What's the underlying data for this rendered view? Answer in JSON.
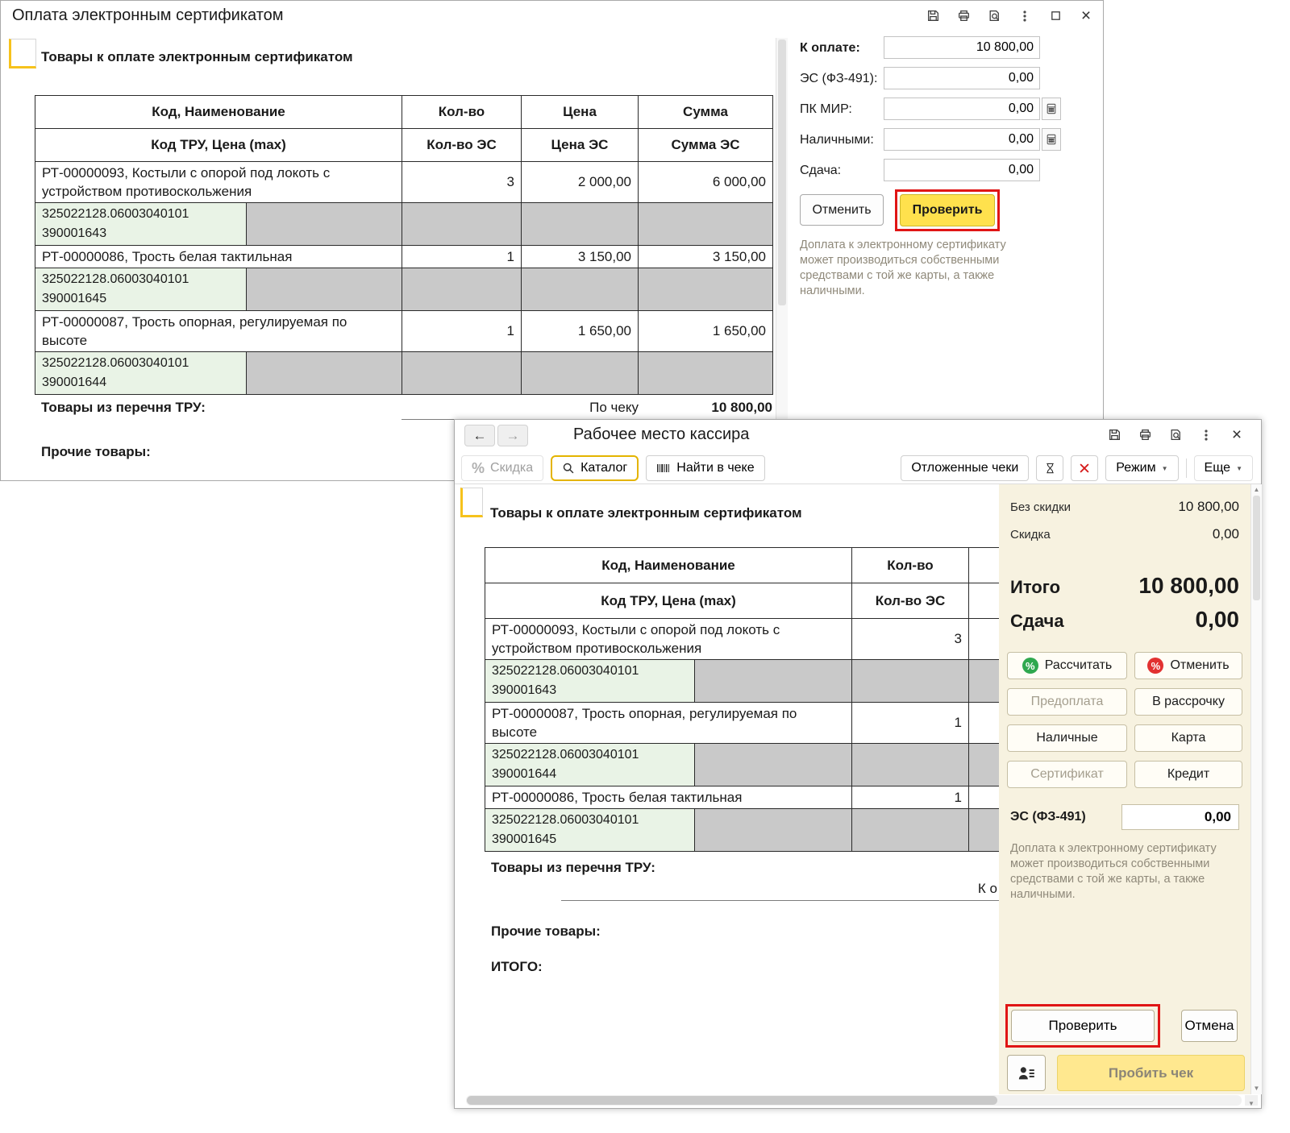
{
  "colors": {
    "accent_yellow": "#ffe14d",
    "annotation_red": "#e01515",
    "panel_beige": "#f7f2e0",
    "tru_green": "#e9f3e6",
    "cell_gray": "#c9c9c9"
  },
  "win1": {
    "title": "Оплата электронным сертификатом",
    "section_header": "Товары к оплате электронным сертификатом",
    "table": {
      "h1": {
        "name": "Код, Наименование",
        "qty": "Кол-во",
        "price": "Цена",
        "sum": "Сумма"
      },
      "h2": {
        "name": "Код ТРУ, Цена (max)",
        "qty": "Кол-во ЭС",
        "price": "Цена ЭС",
        "sum": "Сумма ЭС"
      },
      "rows": [
        {
          "name": "РТ-00000093, Костыли с опорой под локоть с устройством противоскольжения",
          "qty": "3",
          "price": "2 000,00",
          "sum": "6 000,00",
          "tru_code": "325022128.06003040101",
          "tru_code2": "390001643"
        },
        {
          "name": "РТ-00000086, Трость белая тактильная",
          "qty": "1",
          "price": "3 150,00",
          "sum": "3 150,00",
          "tru_code": "325022128.06003040101",
          "tru_code2": "390001645"
        },
        {
          "name": "РТ-00000087, Трость опорная, регулируемая по высоте",
          "qty": "1",
          "price": "1 650,00",
          "sum": "1 650,00",
          "tru_code": "325022128.06003040101",
          "tru_code2": "390001644"
        }
      ],
      "footer_label": "Товары из перечня ТРУ:",
      "by_check": "По чеку",
      "by_check_total": "10 800,00",
      "other_label": "Прочие товары:"
    },
    "pay": {
      "fields": [
        {
          "label": "К оплате:",
          "value": "10 800,00"
        },
        {
          "label": "ЭС (ФЗ-491):",
          "value": "0,00"
        },
        {
          "label": "ПК МИР:",
          "value": "0,00"
        },
        {
          "label": "Наличными:",
          "value": "0,00"
        },
        {
          "label": "Сдача:",
          "value": "0,00"
        }
      ],
      "cancel": "Отменить",
      "check": "Проверить",
      "note": "Доплата к электронному сертификату может производиться собственными средствами с той же карты, а также наличными."
    }
  },
  "win2": {
    "title": "Рабочее место кассира",
    "toolbar": {
      "discount": "Скидка",
      "catalog": "Каталог",
      "find_in_check": "Найти в чеке",
      "deferred": "Отложенные чеки",
      "mode": "Режим",
      "more": "Еще"
    },
    "section_header": "Товары к оплате электронным сертификатом",
    "table": {
      "h1": {
        "name": "Код, Наименование",
        "qty": "Кол-во"
      },
      "h2": {
        "name": "Код ТРУ, Цена (max)",
        "qty": "Кол-во ЭС"
      },
      "rows": [
        {
          "name": "РТ-00000093, Костыли с опорой под локоть с устройством противоскольжения",
          "qty": "3",
          "tru_code": "325022128.06003040101",
          "tru_code2": "390001643"
        },
        {
          "name": "РТ-00000087, Трость опорная, регулируемая по высоте",
          "qty": "1",
          "tru_code": "325022128.06003040101",
          "tru_code2": "390001644"
        },
        {
          "name": "РТ-00000086, Трость белая тактильная",
          "qty": "1",
          "tru_code": "325022128.06003040101",
          "tru_code2": "390001645"
        }
      ],
      "footer_label": "Товары из перечня ТРУ:",
      "cut_value": "К о",
      "other_label": "Прочие товары:",
      "total_label": "ИТОГО:"
    },
    "summary": {
      "no_discount_label": "Без скидки",
      "no_discount_value": "10 800,00",
      "discount_label": "Скидка",
      "discount_value": "0,00",
      "total_label": "Итого",
      "total_value": "10 800,00",
      "change_label": "Сдача",
      "change_value": "0,00",
      "btn_calc": "Рассчитать",
      "btn_cancel": "Отменить",
      "btn_prepay": "Предоплата",
      "btn_installment": "В рассрочку",
      "btn_cash": "Наличные",
      "btn_card": "Карта",
      "btn_cert": "Сертификат",
      "btn_credit": "Кредит",
      "es_label": "ЭС (ФЗ-491)",
      "es_value": "0,00",
      "note": "Доплата к электронному сертификату может производиться собственными средствами с той же карты, а также наличными.",
      "btn_check": "Проверить",
      "btn_cancel2": "Отмена",
      "btn_punch": "Пробить чек"
    }
  }
}
